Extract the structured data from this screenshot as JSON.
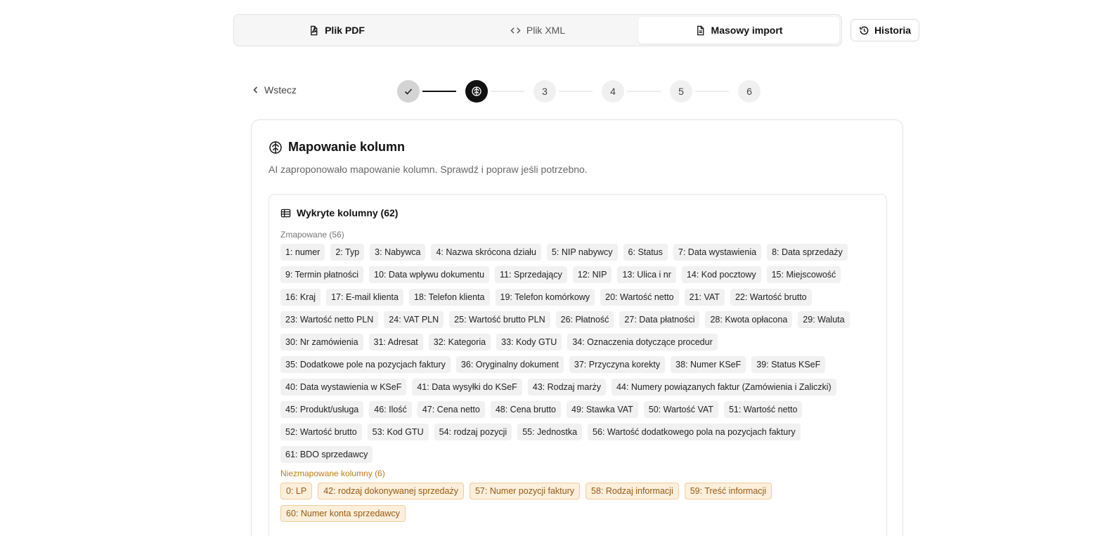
{
  "tabs": [
    {
      "label": "Plik PDF",
      "icon": "file-pdf-icon"
    },
    {
      "label": "Plik XML",
      "icon": "code-icon"
    },
    {
      "label": "Masowy import",
      "icon": "file-text-icon"
    }
  ],
  "history": {
    "label": "Historia",
    "icon": "history-icon"
  },
  "back": {
    "label": "Wstecz"
  },
  "steps": [
    "3",
    "4",
    "5",
    "6"
  ],
  "card": {
    "title": "Mapowanie kolumn",
    "description": "AI zaproponowało mapowanie kolumn. Sprawdź i popraw jeśli potrzebno."
  },
  "detected": {
    "title": "Wykryte kolumny (62)",
    "mapped_label": "Zmapowane (56)",
    "unmapped_label": "Niezmapowane kolumny (6)",
    "mapped": [
      "1: numer",
      "2: Typ",
      "3: Nabywca",
      "4: Nazwa skrócona działu",
      "5: NIP nabywcy",
      "6: Status",
      "7: Data wystawienia",
      "8: Data sprzedaży",
      "9: Termin płatności",
      "10: Data wpływu dokumentu",
      "11: Sprzedający",
      "12: NIP",
      "13: Ulica i nr",
      "14: Kod pocztowy",
      "15: Miejscowość",
      "16: Kraj",
      "17: E-mail klienta",
      "18: Telefon klienta",
      "19: Telefon komórkowy",
      "20: Wartość netto",
      "21: VAT",
      "22: Wartość brutto",
      "23: Wartość netto PLN",
      "24: VAT PLN",
      "25: Wartość brutto PLN",
      "26: Płatność",
      "27: Data płatności",
      "28: Kwota opłacona",
      "29: Waluta",
      "30: Nr zamówienia",
      "31: Adresat",
      "32: Kategoria",
      "33: Kody GTU",
      "34: Oznaczenia dotyczące procedur",
      "35: Dodatkowe pole na pozycjach faktury",
      "36: Oryginalny dokument",
      "37: Przyczyna korekty",
      "38: Numer KSeF",
      "39: Status KSeF",
      "40: Data wystawienia w KSeF",
      "41: Data wysyłki do KSeF",
      "43: Rodzaj marży",
      "44: Numery powiązanych faktur (Zamówienia i Zaliczki)",
      "45: Produkt/usługa",
      "46: Ilość",
      "47: Cena netto",
      "48: Cena brutto",
      "49: Stawka VAT",
      "50: Wartość VAT",
      "51: Wartość netto",
      "52: Wartość brutto",
      "53: Kod GTU",
      "54: rodzaj pozycji",
      "55: Jednostka",
      "56: Wartość dodatkowego pola na pozycjach faktury",
      "61: BDO sprzedawcy"
    ],
    "unmapped": [
      "0: LP",
      "42: rodzaj dokonywanej sprzedaży",
      "57: Numer pozycji faktury",
      "58: Rodzaj informacji",
      "59: Treść informacji",
      "60: Numer konta sprzedawcy"
    ]
  }
}
